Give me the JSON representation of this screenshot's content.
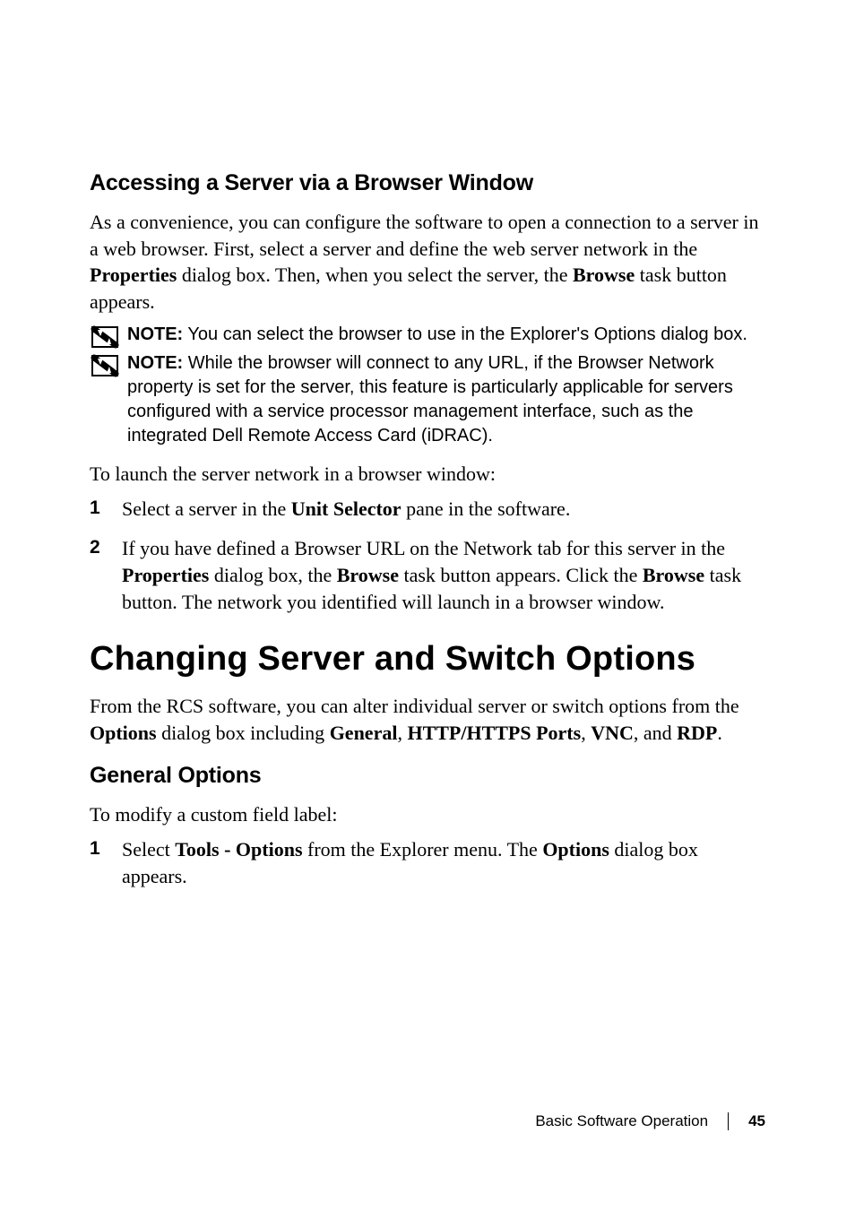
{
  "section1": {
    "heading": "Accessing a Server via a Browser Window",
    "para_parts": [
      "As a convenience, you can configure the software to open a connection to a server in a web browser. First, select a server and define the web server network in the ",
      "Properties",
      " dialog box. Then, when you select the server, the ",
      "Browse",
      " task button appears."
    ],
    "notes": [
      {
        "label": "NOTE:",
        "text": " You can select the browser to use in the Explorer's Options dialog box."
      },
      {
        "label": "NOTE:",
        "text": " While the browser will connect to any URL, if the Browser Network property is set for the server, this feature is particularly applicable for servers configured with a service processor management interface, such as the integrated Dell Remote Access Card (iDRAC)."
      }
    ],
    "para2": "To launch the server network in a browser window:",
    "steps": [
      {
        "num": "1",
        "parts": [
          "Select a server in the ",
          "Unit Selector",
          " pane in the software."
        ]
      },
      {
        "num": "2",
        "parts": [
          "If you have defined a Browser URL on the Network tab for this server in the ",
          "Properties",
          " dialog box, the ",
          "Browse",
          " task button appears. Click the ",
          "Browse",
          " task button. The network you identified will launch in a browser window."
        ]
      }
    ]
  },
  "section2": {
    "heading": "Changing Server and Switch Options",
    "para_parts": [
      "From the RCS software, you can alter individual server or switch options from the ",
      "Options",
      " dialog box including ",
      "General",
      ", ",
      "HTTP/HTTPS Ports",
      ", ",
      "VNC",
      ", and ",
      "RDP",
      "."
    ],
    "sub_heading": "General Options",
    "para2": "To modify a custom field label:",
    "steps": [
      {
        "num": "1",
        "parts": [
          "Select ",
          "Tools - Options",
          " from the Explorer menu. The ",
          "Options",
          " dialog box appears."
        ]
      }
    ]
  },
  "footer": {
    "title": "Basic Software Operation",
    "page": "45"
  }
}
